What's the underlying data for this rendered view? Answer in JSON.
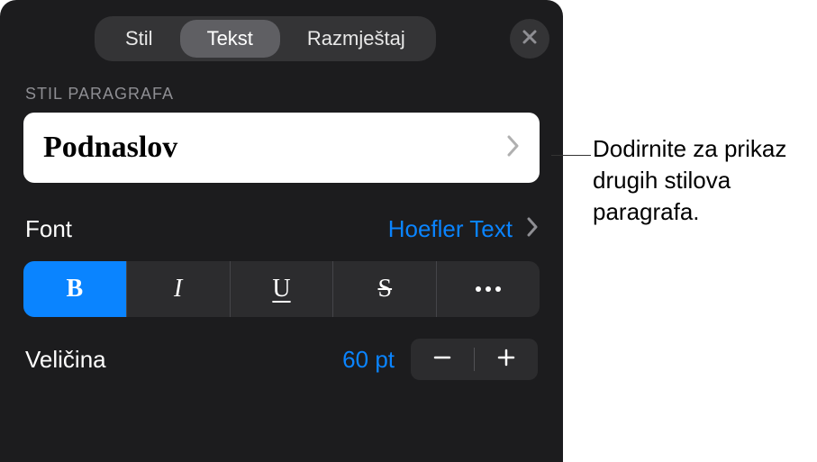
{
  "tabs": {
    "stil": "Stil",
    "tekst": "Tekst",
    "razmjestaj": "Razmještaj"
  },
  "paragraph": {
    "section_label": "STIL PARAGRAFA",
    "current_style": "Podnaslov"
  },
  "font": {
    "label": "Font",
    "value": "Hoefler Text"
  },
  "formatting": {
    "bold": "B",
    "italic": "I",
    "underline": "U",
    "strike": "S"
  },
  "size": {
    "label": "Veličina",
    "value": "60 pt"
  },
  "callout": {
    "text": "Dodirnite za prikaz drugih stilova paragrafa."
  }
}
